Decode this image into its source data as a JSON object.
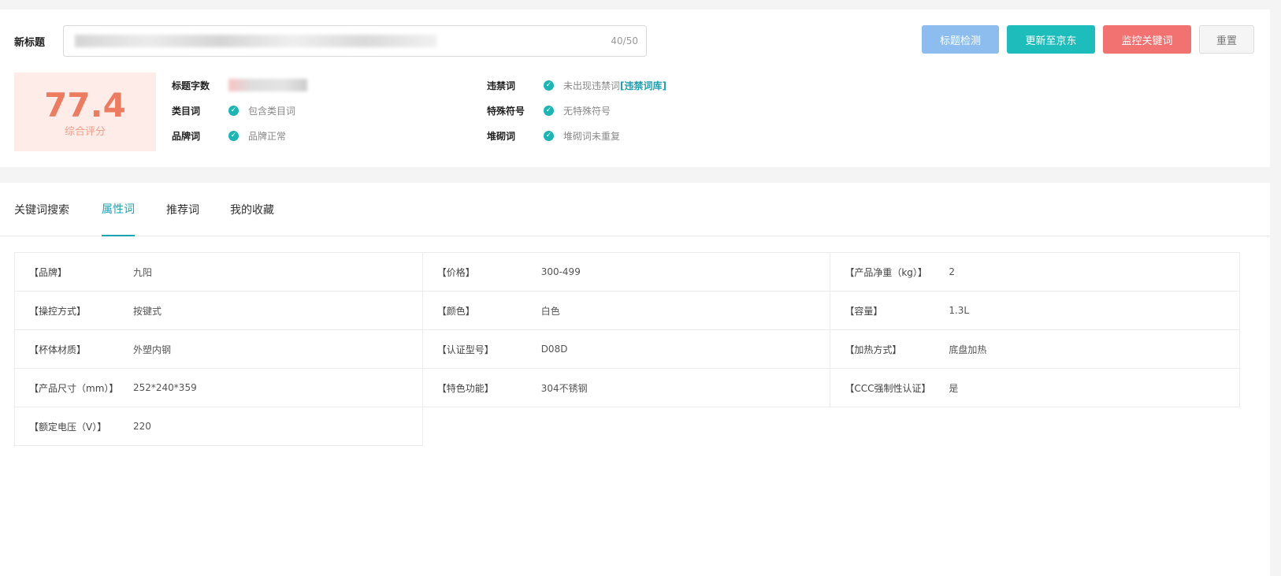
{
  "header": {
    "title_label": "新标题",
    "title_count": "40/50",
    "buttons": {
      "check": "标题检测",
      "update": "更新至京东",
      "monitor": "监控关键词",
      "reset": "重置"
    }
  },
  "score": {
    "value": "77.4",
    "label": "综合评分"
  },
  "checks": {
    "title_length": {
      "label": "标题字数"
    },
    "category": {
      "label": "类目词",
      "text": "包含类目词"
    },
    "brand": {
      "label": "品牌词",
      "text": "品牌正常"
    },
    "banned": {
      "label": "违禁词",
      "text": "未出现违禁词",
      "link": "[违禁词库]"
    },
    "special": {
      "label": "特殊符号",
      "text": "无特殊符号"
    },
    "stacking": {
      "label": "堆砌词",
      "text": "堆砌词未重复"
    }
  },
  "tabs": [
    "关键词搜索",
    "属性词",
    "推荐词",
    "我的收藏"
  ],
  "active_tab": "属性词",
  "attributes": [
    [
      {
        "key": "【品牌】",
        "value": "九阳"
      },
      {
        "key": "【价格】",
        "value": "300-499"
      },
      {
        "key": "【产品净重（kg）】",
        "value": "2"
      }
    ],
    [
      {
        "key": "【操控方式】",
        "value": "按键式"
      },
      {
        "key": "【颜色】",
        "value": "白色"
      },
      {
        "key": "【容量】",
        "value": "1.3L"
      }
    ],
    [
      {
        "key": "【杯体材质】",
        "value": "外塑内钢"
      },
      {
        "key": "【认证型号】",
        "value": "D08D"
      },
      {
        "key": "【加热方式】",
        "value": "底盘加热"
      }
    ],
    [
      {
        "key": "【产品尺寸（mm）】",
        "value": "252*240*359"
      },
      {
        "key": "【特色功能】",
        "value": "304不锈钢"
      },
      {
        "key": "【CCC强制性认证】",
        "value": "是"
      }
    ],
    [
      {
        "key": "【额定电压（V）】",
        "value": "220"
      }
    ]
  ],
  "colors": {
    "accent": "#1aa3b2",
    "score": "#ec7b5f",
    "btn_check": "#8cbdee",
    "btn_update": "#1cbdbb",
    "btn_monitor": "#f27171"
  }
}
